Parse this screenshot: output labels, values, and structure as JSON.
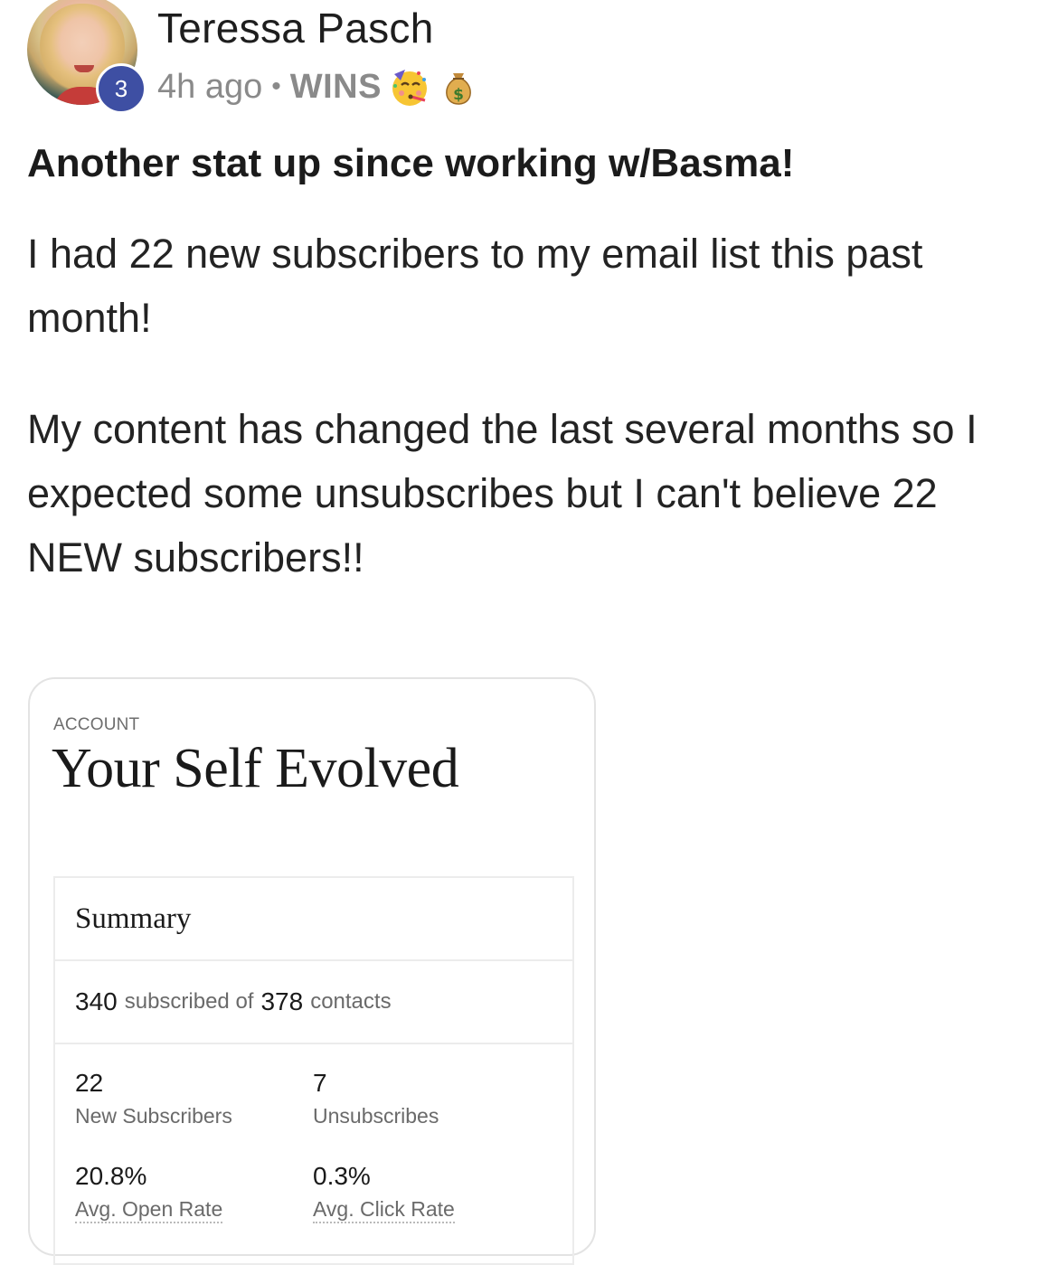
{
  "post": {
    "author": {
      "name": "Teressa Pasch",
      "level": "3"
    },
    "meta": {
      "time": "4h ago",
      "separator": "•",
      "category": "WINS",
      "emojis": [
        "partying-face-icon",
        "money-bag-icon"
      ]
    },
    "title": "Another stat up since working w/Basma!",
    "body": [
      "I had 22 new subscribers to my email list this past month!",
      "My content has changed the last several months so I expected some unsubscribes but I can't believe 22 NEW subscribers!!"
    ]
  },
  "screenshot": {
    "eyebrow": "ACCOUNT",
    "account_name": "Your Self Evolved",
    "summary_title": "Summary",
    "subscribed": "340",
    "subscribed_text": "subscribed of",
    "contacts": "378",
    "contacts_text": "contacts",
    "stats": [
      {
        "value": "22",
        "label": "New Subscribers"
      },
      {
        "value": "7",
        "label": "Unsubscribes"
      },
      {
        "value": "20.8%",
        "label": "Avg. Open Rate"
      },
      {
        "value": "0.3%",
        "label": "Avg. Click Rate"
      }
    ]
  },
  "colors": {
    "badge": "#3e4fa3",
    "meta_text": "#8a8a8a"
  }
}
